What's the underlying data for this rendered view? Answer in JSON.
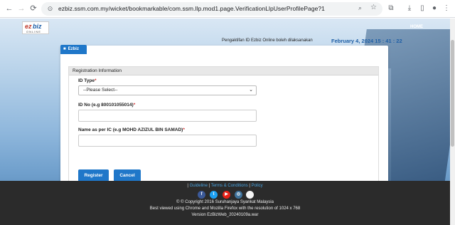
{
  "browser": {
    "url": "ezbiz.ssm.com.my/wicket/bookmarkable/com.ssm.llp.mod1.page.VerificationLlpUserProfilePage?1"
  },
  "header": {
    "logo_text_a": "ez",
    "logo_text_b": "biz",
    "logo_sub": "ONLINE",
    "home_label": "HOME",
    "notice": "Pengaktifan ID Ezbiz Online boleh dilaksanakan",
    "datetime": "February 4, 2024 15 : 41 : 22"
  },
  "card": {
    "tab_label": "Ezbiz",
    "panel_title": "Registration Information",
    "fields": {
      "id_type_label": "ID Type",
      "id_type_value": "--Please Select--",
      "id_no_label": "ID No (e.g 800101055014)",
      "id_no_value": "",
      "name_label": "Name as per IC (e.g MOHD AZIZUL BIN SAMAD)",
      "name_value": ""
    },
    "required_mark": "*",
    "register_label": "Register",
    "cancel_label": "Cancel"
  },
  "footer": {
    "link_guideline": "Guideline",
    "link_terms": "Terms & Conditions",
    "link_policy": "Policy",
    "sep": "|",
    "social": [
      {
        "name": "facebook-icon",
        "glyph": "f",
        "color": "#3b5998"
      },
      {
        "name": "twitter-icon",
        "glyph": "t",
        "color": "#1da1f2"
      },
      {
        "name": "youtube-icon",
        "glyph": "▶",
        "color": "#e62117"
      },
      {
        "name": "instagram-icon",
        "glyph": "◎",
        "color": "#3f729b"
      },
      {
        "name": "other-icon",
        "glyph": "",
        "color": "#f5f5f5"
      }
    ],
    "copyright": "© © Copyright 2016 Suruhanjaya Syarikat Malaysia",
    "best_viewed": "Best viewed using Chrome and Mozilla Firefox with the resolution of 1024 x 768",
    "version": "Version EzBizWeb_20240109a.war"
  },
  "colors": {
    "accent": "#1f77c9",
    "datetime": "#1f5fa6",
    "footer_bg": "#2b2b2b"
  }
}
